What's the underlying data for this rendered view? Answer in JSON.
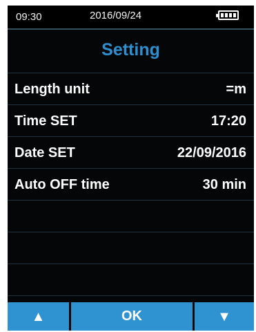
{
  "status_bar": {
    "time": "09:30",
    "date": "2016/09/24",
    "battery_icon": "battery-full-icon"
  },
  "screen": {
    "title": "Setting"
  },
  "menu": {
    "items": [
      {
        "label": "Length unit",
        "value": "=m"
      },
      {
        "label": "Time SET",
        "value": "17:20"
      },
      {
        "label": "Date SET",
        "value": "22/09/2016"
      },
      {
        "label": "Auto OFF time",
        "value": "30 min"
      }
    ]
  },
  "soft_buttons": {
    "up_icon": "up-arrow-icon",
    "up_symbol": "▲",
    "ok_label": "OK",
    "down_icon": "down-arrow-icon",
    "down_symbol": "▼"
  },
  "colors": {
    "title_blue": "#2d8fd0",
    "button_blue": "#2f93d1",
    "screen_black": "#050607",
    "divider": "#213240",
    "text": "#ffffff"
  }
}
